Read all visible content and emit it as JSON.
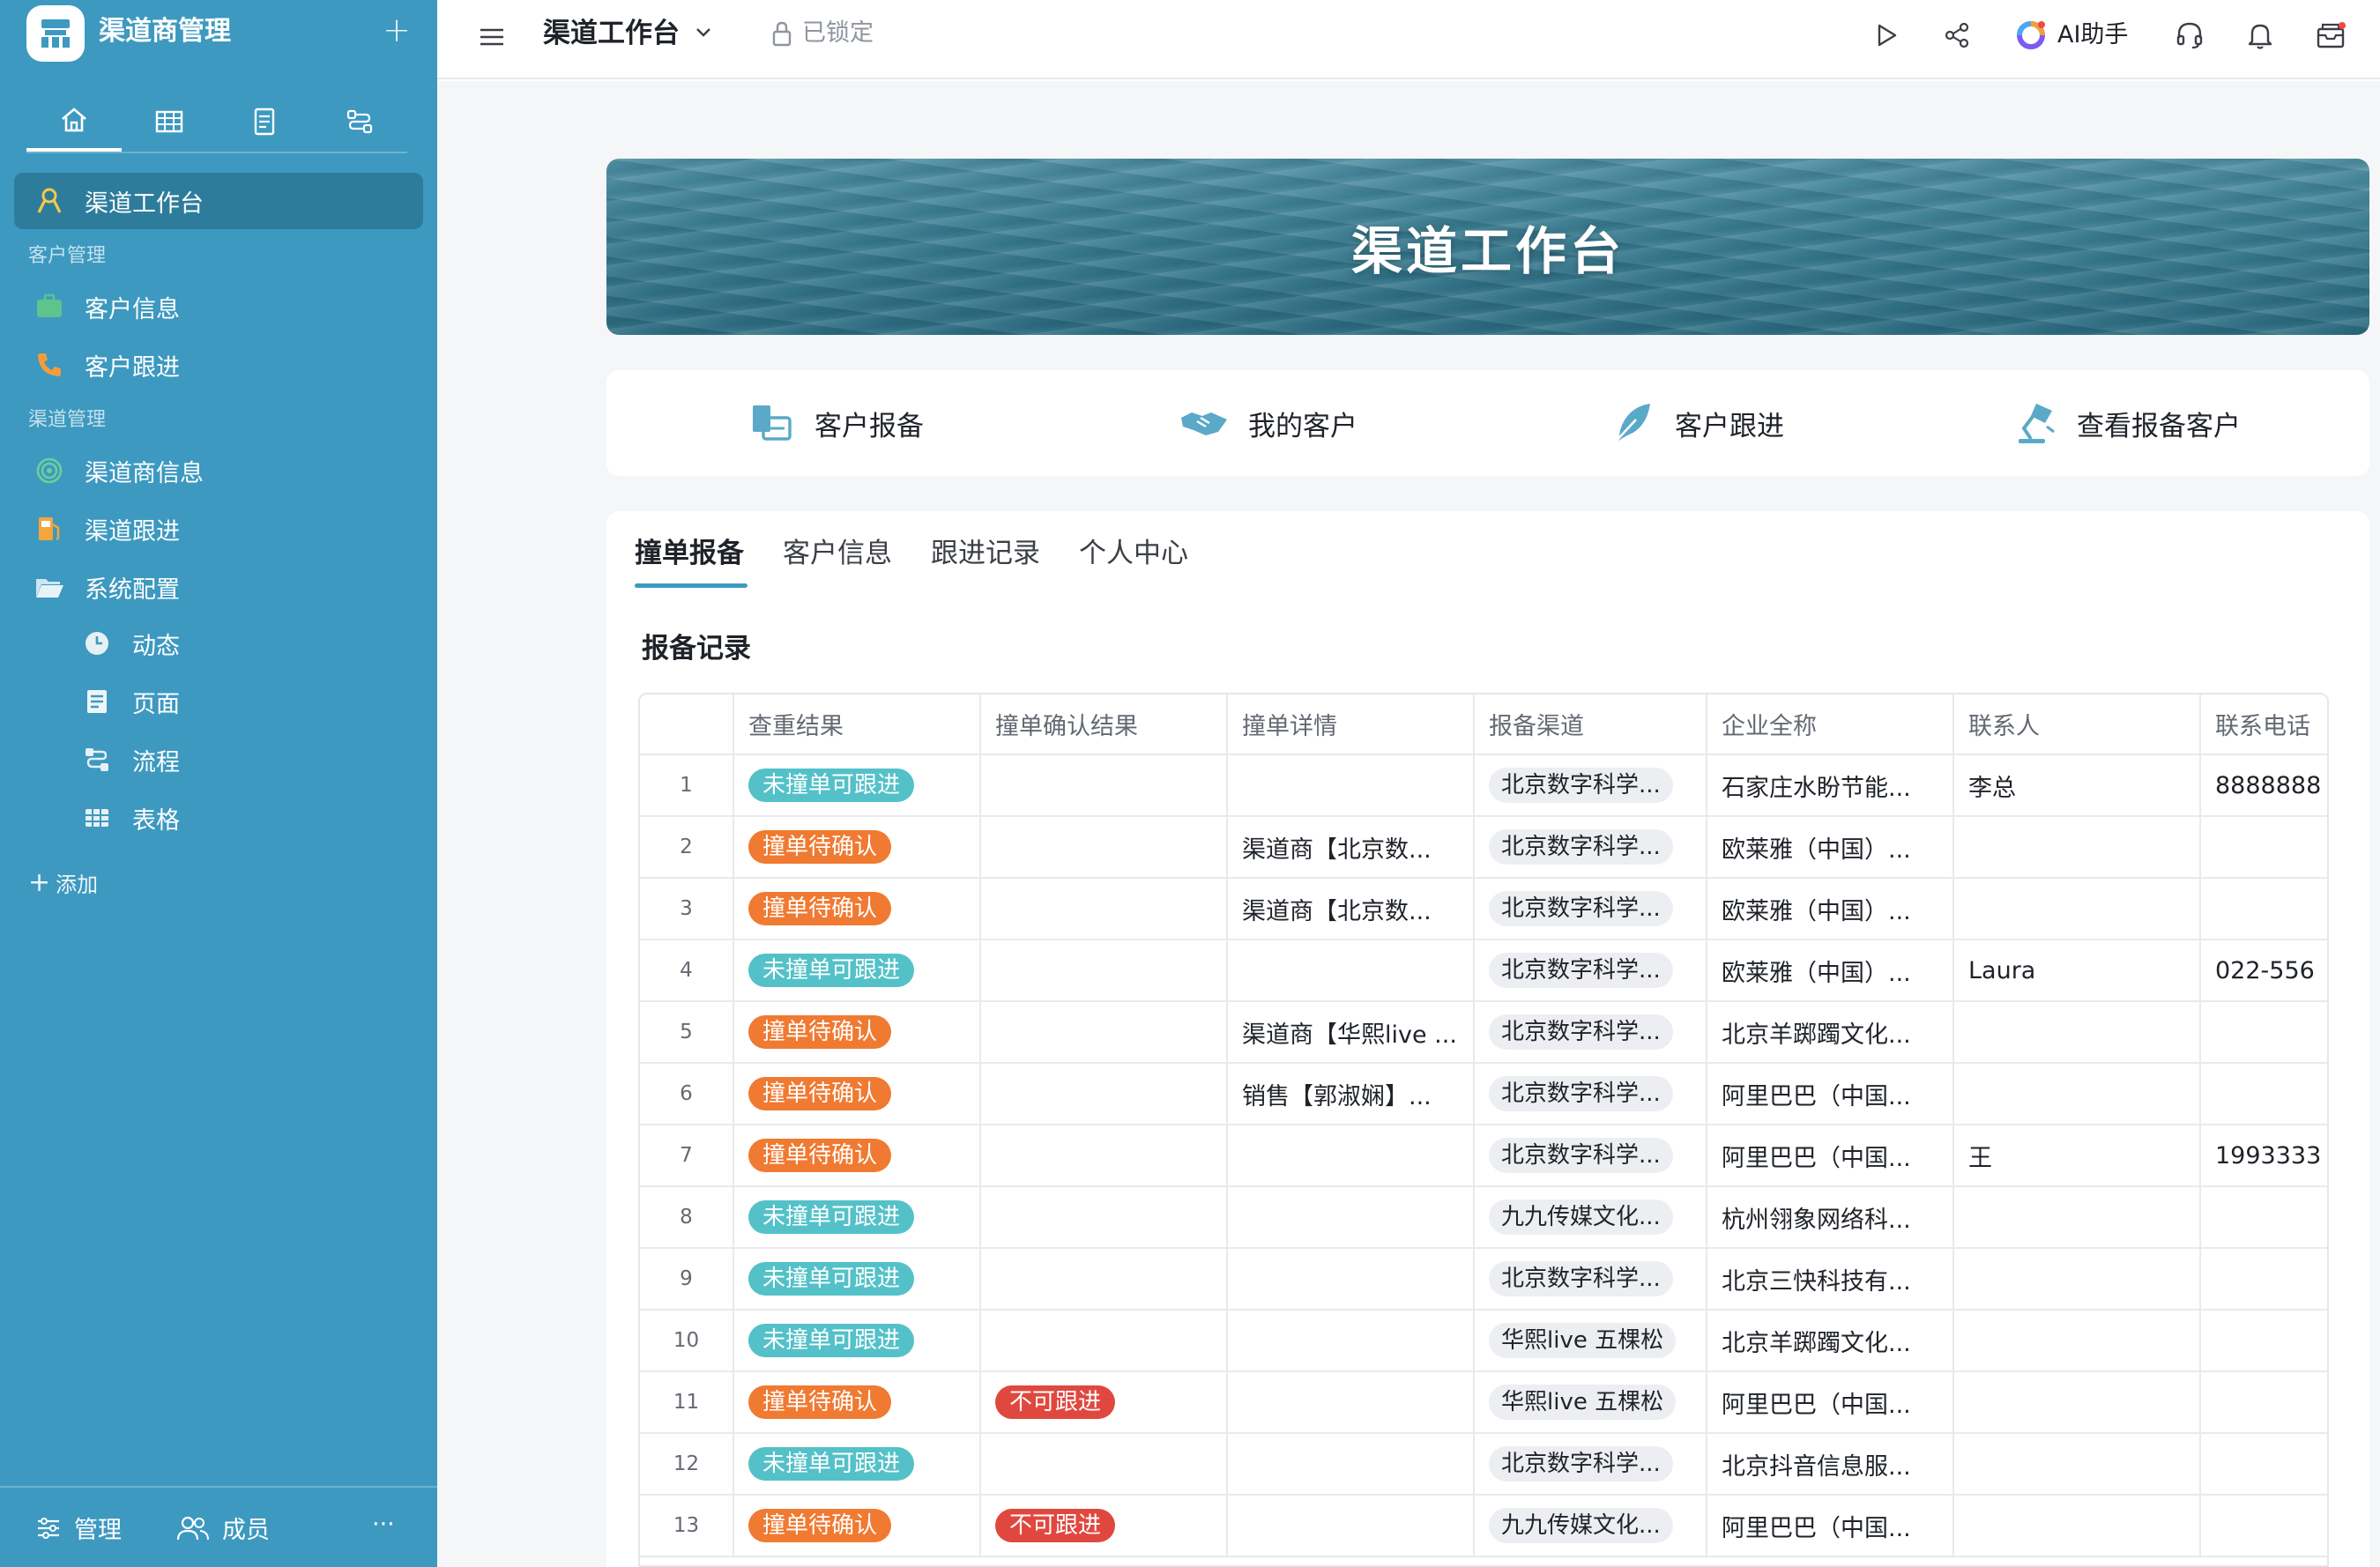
{
  "sidebar": {
    "app_title": "渠道商管理",
    "plus": "+",
    "active_item": "渠道工作台",
    "sections": {
      "customer": "客户管理",
      "channel": "渠道管理"
    },
    "customer_items": [
      "客户信息",
      "客户跟进"
    ],
    "channel_items": [
      "渠道商信息",
      "渠道跟进",
      "系统配置"
    ],
    "config_sub_items": [
      "动态",
      "页面",
      "流程",
      "表格"
    ],
    "add_label": "添加",
    "footer": {
      "manage": "管理",
      "members": "成员",
      "more": "···"
    }
  },
  "topbar": {
    "title": "渠道工作台",
    "lock_label": "已锁定",
    "ai_label": "AI助手"
  },
  "banner": {
    "title": "渠道工作台"
  },
  "quick_actions": [
    "客户报备",
    "我的客户",
    "客户跟进",
    "查看报备客户"
  ],
  "tabs": [
    "撞单报备",
    "客户信息",
    "跟进记录",
    "个人中心"
  ],
  "section_title": "报备记录",
  "table": {
    "columns": [
      "查重结果",
      "撞单确认结果",
      "撞单详情",
      "报备渠道",
      "企业全称",
      "联系人",
      "联系电话"
    ],
    "rows": [
      {
        "no": "1",
        "check": "未撞单可跟进",
        "check_type": "teal",
        "confirm": "",
        "detail": "",
        "channel": "北京数字科学...",
        "company": "石家庄水盼节能...",
        "contact": "李总",
        "phone": "8888888"
      },
      {
        "no": "2",
        "check": "撞单待确认",
        "check_type": "orange",
        "confirm": "",
        "detail": "渠道商【北京数...",
        "channel": "北京数字科学...",
        "company": "欧莱雅（中国）...",
        "contact": "",
        "phone": ""
      },
      {
        "no": "3",
        "check": "撞单待确认",
        "check_type": "orange",
        "confirm": "",
        "detail": "渠道商【北京数...",
        "channel": "北京数字科学...",
        "company": "欧莱雅（中国）...",
        "contact": "",
        "phone": ""
      },
      {
        "no": "4",
        "check": "未撞单可跟进",
        "check_type": "teal",
        "confirm": "",
        "detail": "",
        "channel": "北京数字科学...",
        "company": "欧莱雅（中国）...",
        "contact": "Laura",
        "phone": "022-556"
      },
      {
        "no": "5",
        "check": "撞单待确认",
        "check_type": "orange",
        "confirm": "",
        "detail": "渠道商【华熙live ...",
        "channel": "北京数字科学...",
        "company": "北京羊踯躅文化...",
        "contact": "",
        "phone": ""
      },
      {
        "no": "6",
        "check": "撞单待确认",
        "check_type": "orange",
        "confirm": "",
        "detail": "销售【郭淑娴】...",
        "channel": "北京数字科学...",
        "company": "阿里巴巴（中国...",
        "contact": "",
        "phone": ""
      },
      {
        "no": "7",
        "check": "撞单待确认",
        "check_type": "orange",
        "confirm": "",
        "detail": "",
        "channel": "北京数字科学...",
        "company": "阿里巴巴（中国...",
        "contact": "王",
        "phone": "1993333"
      },
      {
        "no": "8",
        "check": "未撞单可跟进",
        "check_type": "teal",
        "confirm": "",
        "detail": "",
        "channel": "九九传媒文化...",
        "company": "杭州翎象网络科...",
        "contact": "",
        "phone": ""
      },
      {
        "no": "9",
        "check": "未撞单可跟进",
        "check_type": "teal",
        "confirm": "",
        "detail": "",
        "channel": "北京数字科学...",
        "company": "北京三快科技有...",
        "contact": "",
        "phone": ""
      },
      {
        "no": "10",
        "check": "未撞单可跟进",
        "check_type": "teal",
        "confirm": "",
        "detail": "",
        "channel": "华熙live 五棵松",
        "company": "北京羊踯躅文化...",
        "contact": "",
        "phone": ""
      },
      {
        "no": "11",
        "check": "撞单待确认",
        "check_type": "orange",
        "confirm": "不可跟进",
        "detail": "",
        "channel": "华熙live 五棵松",
        "company": "阿里巴巴（中国...",
        "contact": "",
        "phone": ""
      },
      {
        "no": "12",
        "check": "未撞单可跟进",
        "check_type": "teal",
        "confirm": "",
        "detail": "",
        "channel": "北京数字科学...",
        "company": "北京抖音信息服...",
        "contact": "",
        "phone": ""
      },
      {
        "no": "13",
        "check": "撞单待确认",
        "check_type": "orange",
        "confirm": "不可跟进",
        "detail": "",
        "channel": "九九传媒文化...",
        "company": "阿里巴巴（中国...",
        "contact": "",
        "phone": ""
      }
    ]
  },
  "colors": {
    "sidebar_bg": "#3d99c0",
    "sidebar_active": "#2e7c9c",
    "tag_teal": "#54c1c8",
    "tag_orange": "#f07a32",
    "tag_red": "#e0483f",
    "accent": "#3d99c0"
  }
}
